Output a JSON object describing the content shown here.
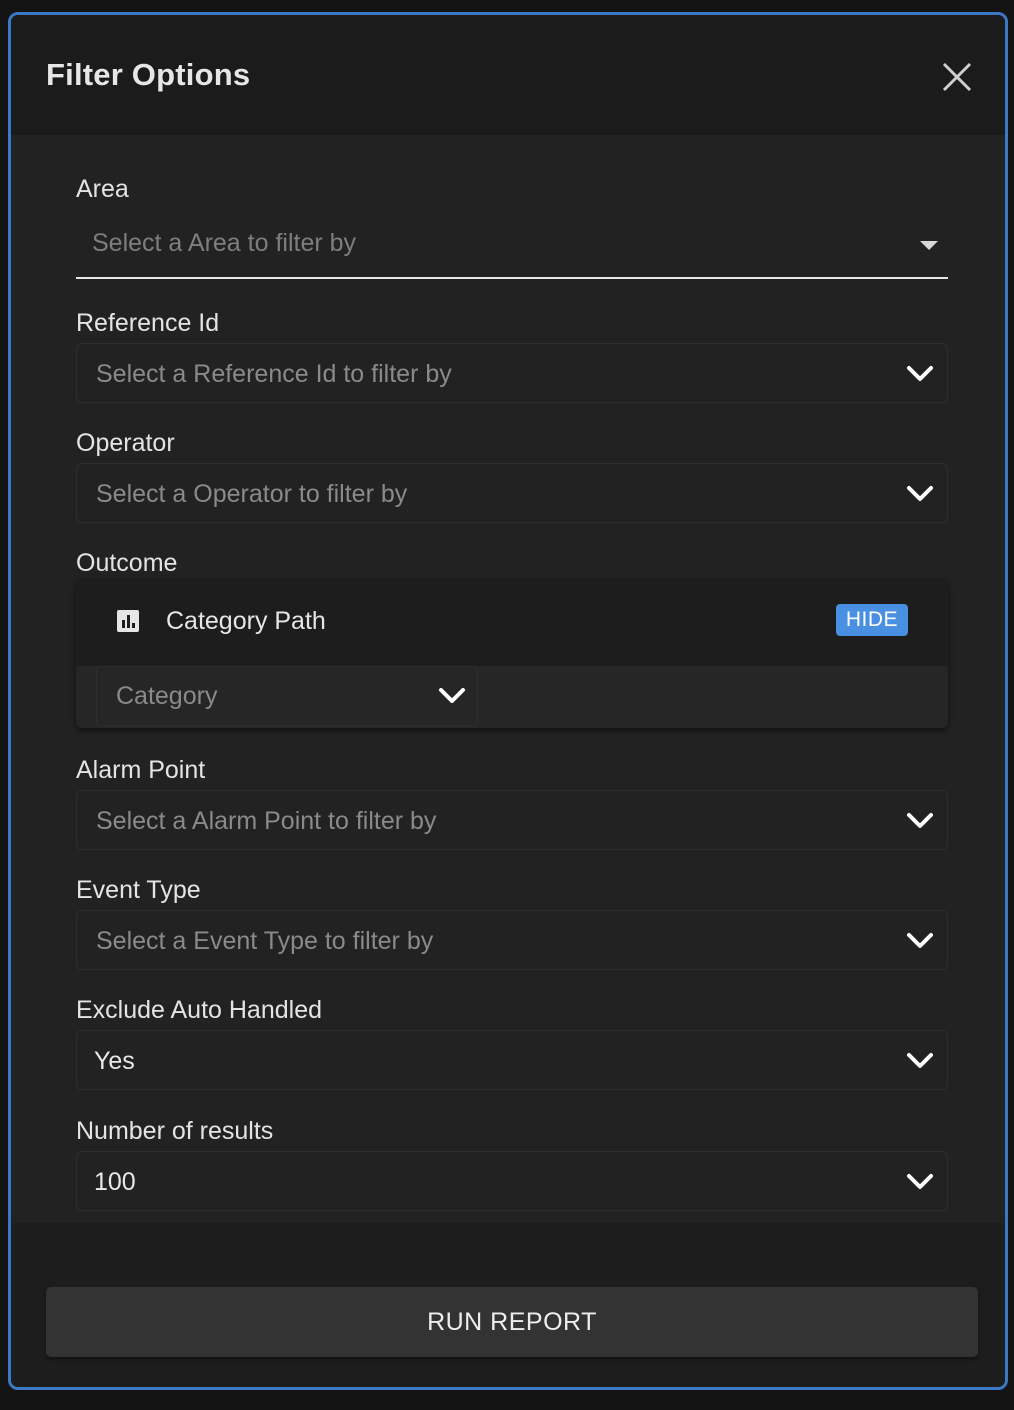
{
  "modal": {
    "title": "Filter Options",
    "close_icon": "close-icon"
  },
  "fields": {
    "area": {
      "label": "Area",
      "placeholder": "Select a Area to filter by"
    },
    "reference_id": {
      "label": "Reference Id",
      "placeholder": "Select a Reference Id to filter by"
    },
    "operator": {
      "label": "Operator",
      "placeholder": "Select a Operator to filter by"
    },
    "outcome": {
      "label": "Outcome",
      "panel_title": "Category Path",
      "panel_icon": "bar-chart-icon",
      "hide_label": "HIDE",
      "category_placeholder": "Category"
    },
    "alarm_point": {
      "label": "Alarm Point",
      "placeholder": "Select a Alarm Point to filter by"
    },
    "event_type": {
      "label": "Event Type",
      "placeholder": "Select a Event Type to filter by"
    },
    "exclude_auto_handled": {
      "label": "Exclude Auto Handled",
      "value": "Yes"
    },
    "number_of_results": {
      "label": "Number of results",
      "value": "100"
    }
  },
  "footer": {
    "run_label": "RUN REPORT"
  },
  "colors": {
    "accent": "#4a90e2",
    "modal_border": "#3b78c6",
    "background": "#202020"
  }
}
